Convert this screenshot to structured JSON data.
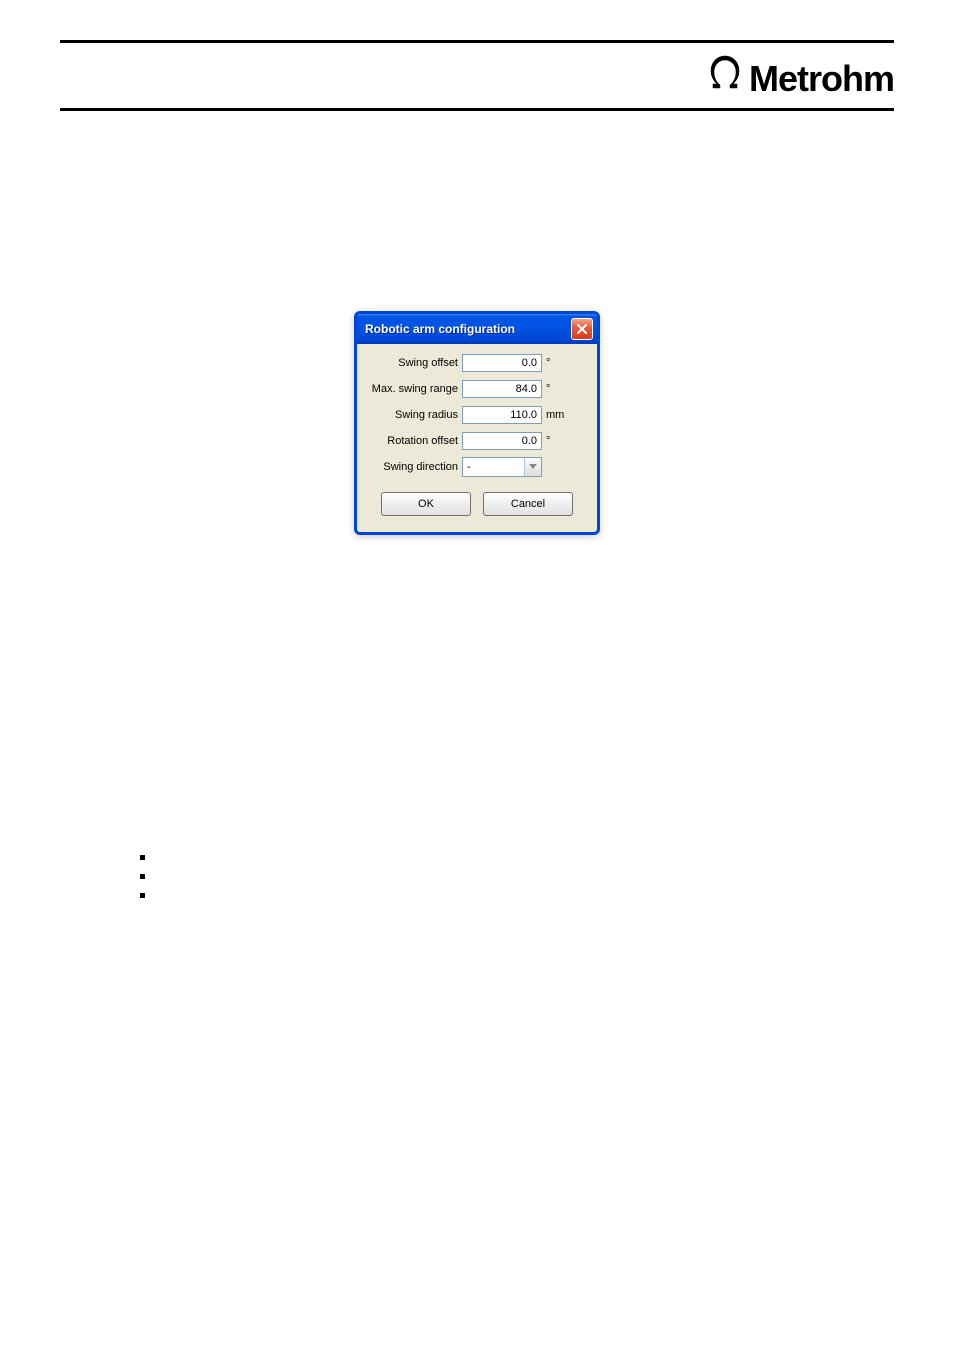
{
  "brand": {
    "name": "Metrohm"
  },
  "dialog": {
    "title": "Robotic arm configuration",
    "fields": {
      "swing_offset": {
        "label": "Swing offset",
        "value": "0.0",
        "unit": "°"
      },
      "max_swing_range": {
        "label": "Max. swing range",
        "value": "84.0",
        "unit": "°"
      },
      "swing_radius": {
        "label": "Swing radius",
        "value": "110.0",
        "unit": "mm"
      },
      "rotation_offset": {
        "label": "Rotation offset",
        "value": "0.0",
        "unit": "°"
      },
      "swing_direction": {
        "label": "Swing direction",
        "value": "-"
      }
    },
    "buttons": {
      "ok": "OK",
      "cancel": "Cancel"
    }
  }
}
